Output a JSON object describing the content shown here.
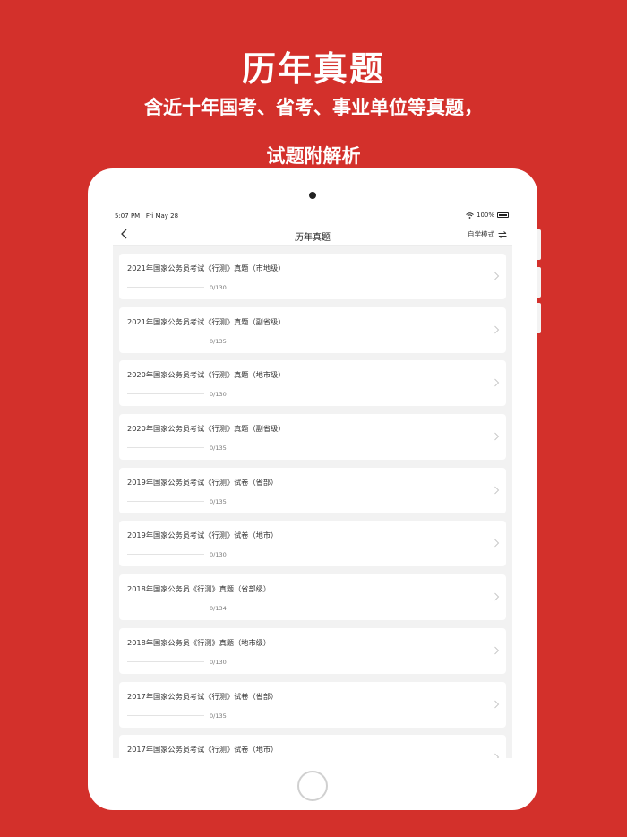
{
  "promo": {
    "title": "历年真题",
    "line1": "含近十年国考、省考、事业单位等真题，",
    "line2": "试题附解析"
  },
  "status_bar": {
    "time": "5:07 PM",
    "date": "Fri May 28",
    "battery": "100%",
    "icons": [
      "wifi-icon",
      "battery-icon"
    ]
  },
  "nav": {
    "title": "历年真题",
    "mode_label": "自学模式",
    "icons": [
      "back-chevron-icon",
      "swap-arrows-icon"
    ]
  },
  "colors": {
    "brand": "#d3302b",
    "screen_bg": "#f2f2f2"
  },
  "exams": [
    {
      "title": "2021年国家公务员考试《行测》真题（市地级）",
      "progress": "0/130",
      "done": 0,
      "total": 130
    },
    {
      "title": "2021年国家公务员考试《行测》真题（副省级）",
      "progress": "0/135",
      "done": 0,
      "total": 135
    },
    {
      "title": "2020年国家公务员考试《行测》真题（地市级）",
      "progress": "0/130",
      "done": 0,
      "total": 130
    },
    {
      "title": "2020年国家公务员考试《行测》真题（副省级）",
      "progress": "0/135",
      "done": 0,
      "total": 135
    },
    {
      "title": "2019年国家公务员考试《行测》试卷（省部）",
      "progress": "0/135",
      "done": 0,
      "total": 135
    },
    {
      "title": "2019年国家公务员考试《行测》试卷（地市）",
      "progress": "0/130",
      "done": 0,
      "total": 130
    },
    {
      "title": "2018年国家公务员《行测》真题（省部级）",
      "progress": "0/134",
      "done": 0,
      "total": 134
    },
    {
      "title": "2018年国家公务员《行测》真题（地市级）",
      "progress": "0/130",
      "done": 0,
      "total": 130
    },
    {
      "title": "2017年国家公务员考试《行测》试卷（省部）",
      "progress": "0/135",
      "done": 0,
      "total": 135
    },
    {
      "title": "2017年国家公务员考试《行测》试卷（地市）",
      "progress": "",
      "done": 0,
      "total": 0
    }
  ]
}
